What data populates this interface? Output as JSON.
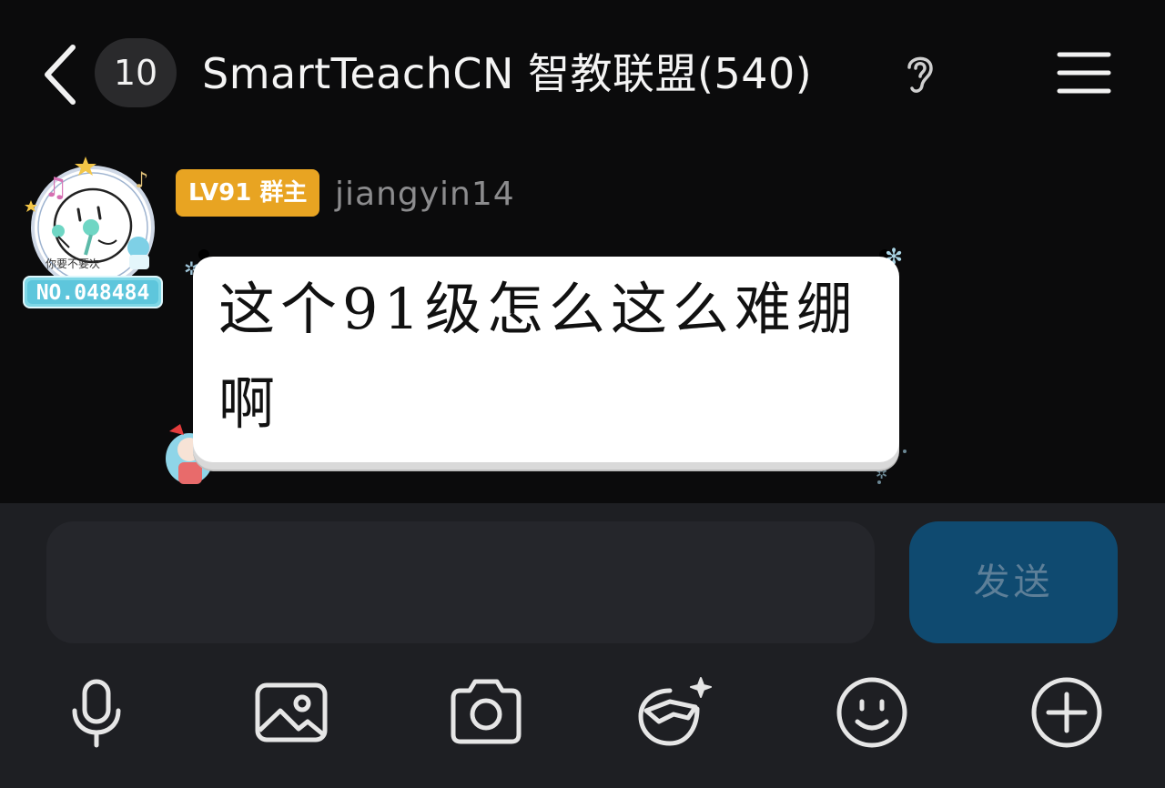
{
  "header": {
    "unread_count": "10",
    "title": "SmartTeachCN 智教联盟(540)",
    "icons": [
      "back-arrow-icon",
      "ear-icon",
      "menu-icon"
    ]
  },
  "message": {
    "avatar_badge_text": "NO.048484",
    "avatar_caption": "你要不要次",
    "level_badge": "LV91 群主",
    "sender": "jiangyin14",
    "text": "这个91级怎么这么难绷啊",
    "colors": {
      "level_badge": "#e8a422",
      "bubble": "#ffffff"
    }
  },
  "composer": {
    "input_value": "",
    "send_label": "发送",
    "colors": {
      "send_bg": "#0f4a70",
      "send_text": "#5d7f98"
    },
    "toolbar": [
      "microphone-icon",
      "image-icon",
      "camera-icon",
      "sticker-icon",
      "emoji-icon",
      "plus-icon"
    ]
  }
}
